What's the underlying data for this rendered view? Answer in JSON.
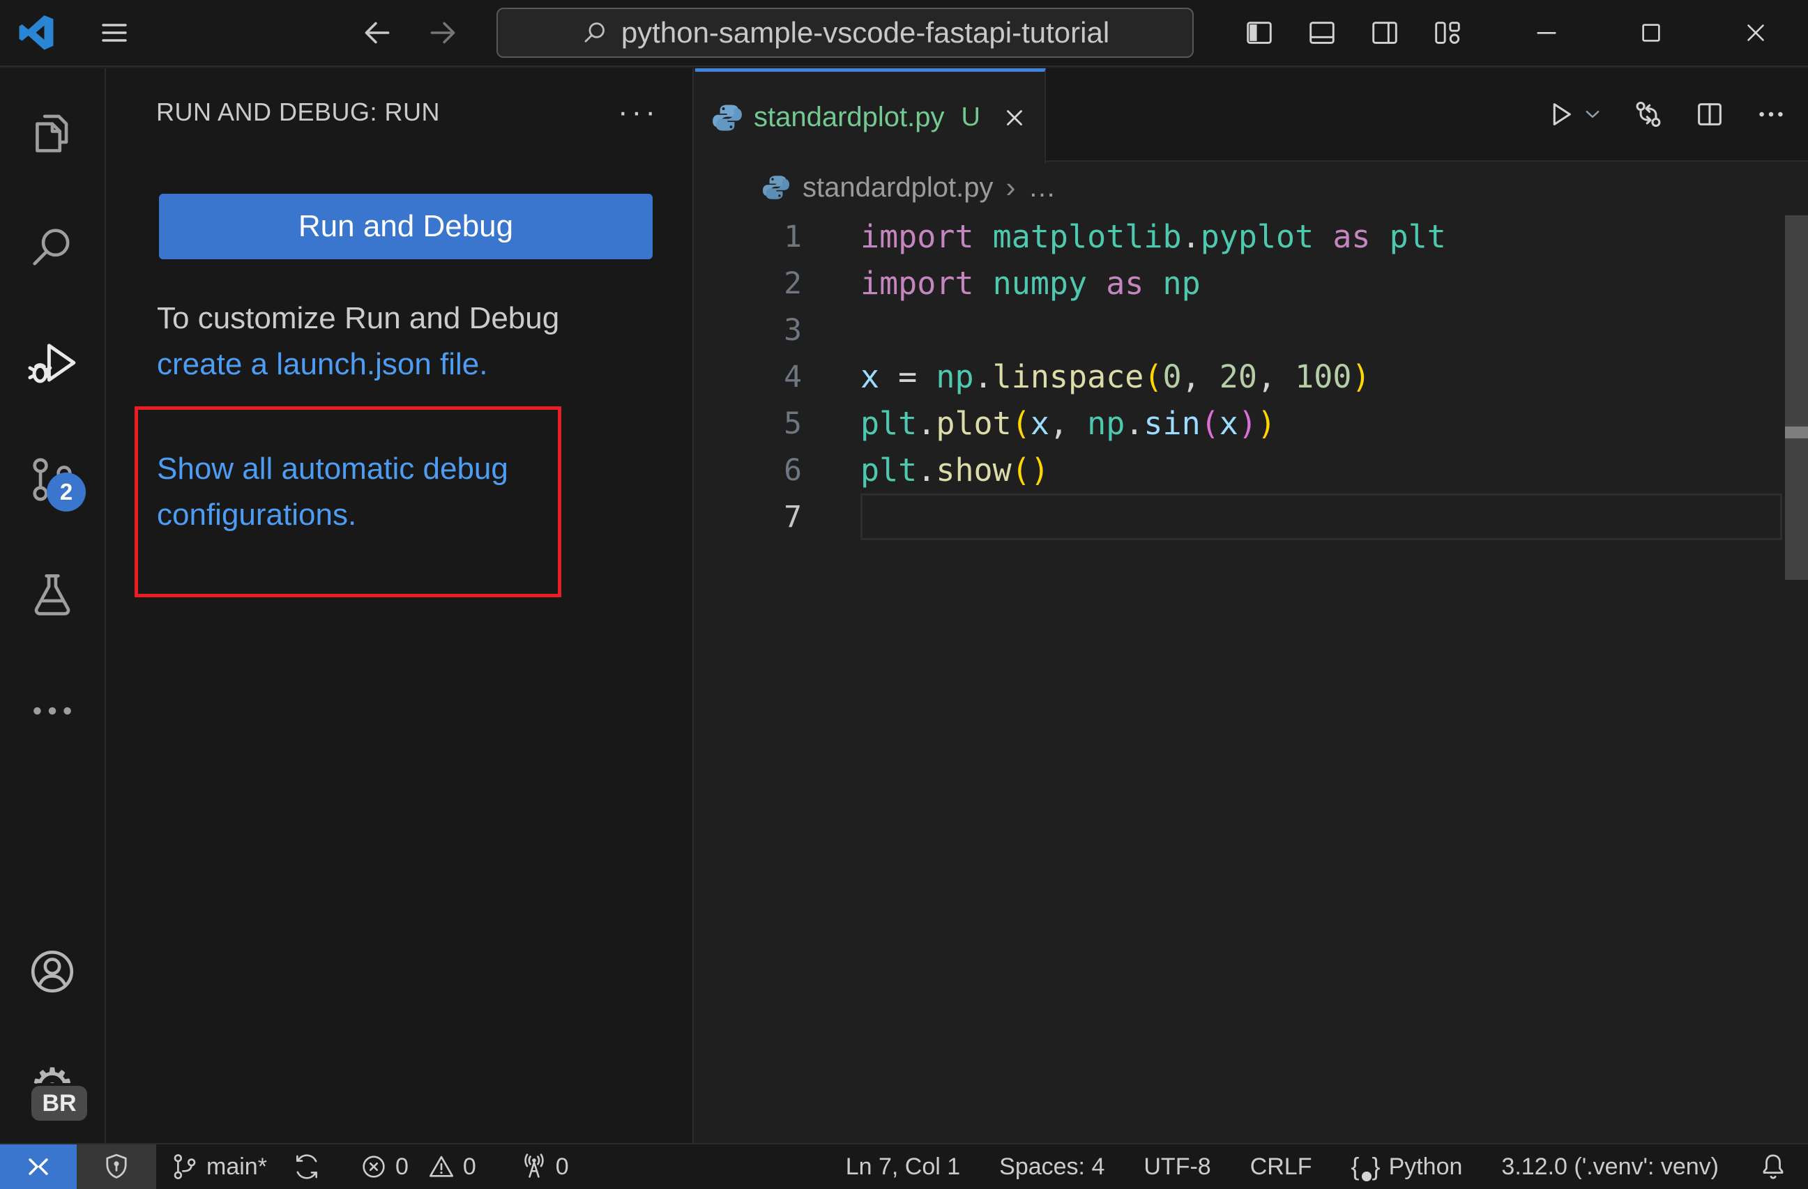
{
  "colors": {
    "chrome_bg": "#181818",
    "editor_bg": "#1f1f1f",
    "border": "#2b2b2b",
    "text": "#cccccc",
    "accent": "#3a76cd",
    "tab_border": "#3f83dc",
    "link": "#4c9df3",
    "annotation_red": "#ea1c24",
    "git_green": "#73c991",
    "tok_kw": "#c586c0",
    "tok_mod": "#4ec9b0",
    "tok_fn": "#dcdcaa",
    "tok_var": "#9cdcfe",
    "tok_num": "#b5cea8",
    "tok_op": "#d4d4d4",
    "tok_b1": "#ffd700",
    "tok_b2": "#da70d6"
  },
  "window": {
    "search_value": "python-sample-vscode-fastapi-tutorial"
  },
  "sidebar": {
    "title": "RUN AND DEBUG: RUN",
    "more_actions": "···",
    "run_button": "Run and Debug",
    "customize_text": "To customize Run and Debug",
    "customize_link": "create a launch.json file.",
    "auto_config_link_line1": "Show all automatic debug",
    "auto_config_link_line2": "configurations."
  },
  "editor": {
    "tab": {
      "file": "standardplot.py",
      "dirty_badge": "U"
    },
    "breadcrumb": {
      "file": "standardplot.py",
      "separator": "›",
      "symbol": "…"
    },
    "code": {
      "lines": [
        {
          "num": "1",
          "tokens": [
            [
              "kw",
              "import"
            ],
            [
              "op",
              " "
            ],
            [
              "mod",
              "matplotlib"
            ],
            [
              "op",
              "."
            ],
            [
              "mod",
              "pyplot"
            ],
            [
              "op",
              " "
            ],
            [
              "kw",
              "as"
            ],
            [
              "op",
              " "
            ],
            [
              "mod",
              "plt"
            ]
          ]
        },
        {
          "num": "2",
          "tokens": [
            [
              "kw",
              "import"
            ],
            [
              "op",
              " "
            ],
            [
              "mod",
              "numpy"
            ],
            [
              "op",
              " "
            ],
            [
              "kw",
              "as"
            ],
            [
              "op",
              " "
            ],
            [
              "mod",
              "np"
            ]
          ]
        },
        {
          "num": "3",
          "tokens": []
        },
        {
          "num": "4",
          "tokens": [
            [
              "var",
              "x"
            ],
            [
              "op",
              " = "
            ],
            [
              "mod",
              "np"
            ],
            [
              "op",
              "."
            ],
            [
              "fn",
              "linspace"
            ],
            [
              "b1",
              "("
            ],
            [
              "num",
              "0"
            ],
            [
              "op",
              ", "
            ],
            [
              "num",
              "20"
            ],
            [
              "op",
              ", "
            ],
            [
              "num",
              "100"
            ],
            [
              "b1",
              ")"
            ]
          ]
        },
        {
          "num": "5",
          "tokens": [
            [
              "mod",
              "plt"
            ],
            [
              "op",
              "."
            ],
            [
              "fn",
              "plot"
            ],
            [
              "b1",
              "("
            ],
            [
              "var",
              "x"
            ],
            [
              "op",
              ", "
            ],
            [
              "mod",
              "np"
            ],
            [
              "op",
              "."
            ],
            [
              "var",
              "sin"
            ],
            [
              "b2",
              "("
            ],
            [
              "var",
              "x"
            ],
            [
              "b2",
              ")"
            ],
            [
              "b1",
              ")"
            ]
          ]
        },
        {
          "num": "6",
          "tokens": [
            [
              "mod",
              "plt"
            ],
            [
              "op",
              "."
            ],
            [
              "fn",
              "show"
            ],
            [
              "b1",
              "("
            ],
            [
              "b1",
              ")"
            ]
          ]
        },
        {
          "num": "7",
          "tokens": [],
          "current": true
        }
      ]
    }
  },
  "activity_bar": {
    "scm_badge": "2",
    "profile_badge": "BR"
  },
  "status_bar": {
    "branch": "main*",
    "errors": "0",
    "warnings": "0",
    "ports": "0",
    "line_col": "Ln 7, Col 1",
    "indent": "Spaces: 4",
    "encoding": "UTF-8",
    "eol": "CRLF",
    "language": "Python",
    "interpreter": "3.12.0 ('.venv': venv)"
  },
  "icons": {
    "vscode-logo": "vscode brand mark",
    "menu-icon": "hamburger",
    "back-arrow-icon": "left arrow",
    "forward-arrow-icon": "right arrow",
    "search-icon": "magnifier",
    "layout-sidebar-left-icon": "panel left filled",
    "layout-panel-icon": "panel bottom",
    "layout-sidebar-right-icon": "panel right",
    "layout-customize-icon": "layout grid",
    "minimize-icon": "horizontal line",
    "maximize-icon": "square outline",
    "close-icon": "x",
    "files-icon": "explorer documents",
    "run-debug-icon": "play triangle with bug",
    "source-control-icon": "branch nodes",
    "testing-icon": "beaker flask",
    "ellipsis-icon": "three dots",
    "account-icon": "person in circle",
    "settings-gear-icon": "gear",
    "python-icon": "python logo",
    "run-icon": "play triangle",
    "chevron-down-icon": "chevron down",
    "compare-changes-icon": "two circles with arrows",
    "split-editor-icon": "split rectangle",
    "remote-icon": "open remote window ><",
    "shield-icon": "workspace trust shield",
    "git-branch-icon": "branch",
    "sync-icon": "circular arrows",
    "error-icon": "circle with x",
    "warning-icon": "triangle with exclamation",
    "radio-tower-icon": "ports radio tower",
    "bell-icon": "notifications bell"
  }
}
